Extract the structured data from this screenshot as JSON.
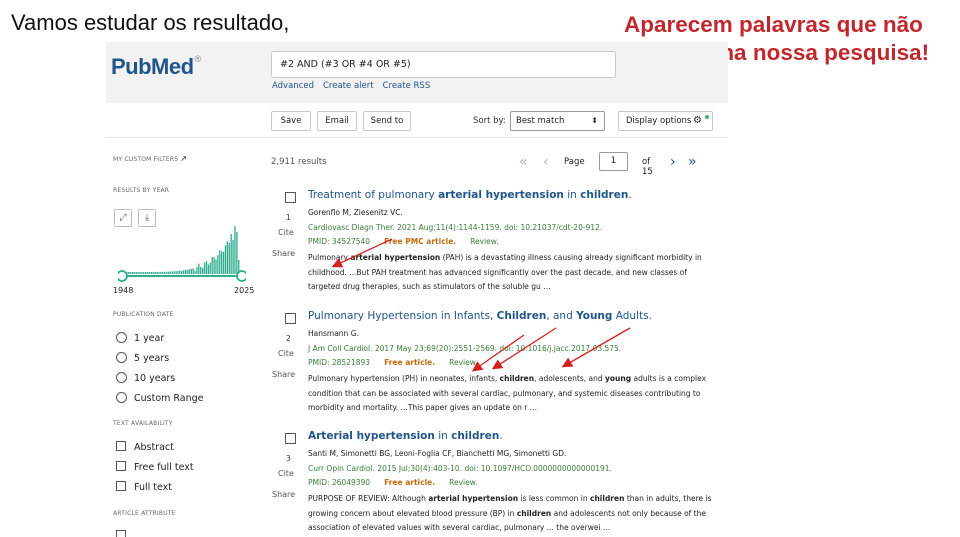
{
  "slide": {
    "caption": "Vamos estudar os resultado,",
    "note": "Aparecem palavras que não estavam na nossa pesquisa!",
    "note_color": "#c0282d"
  },
  "header": {
    "logo": "PubMed",
    "logo_mark": "®",
    "search_value": "#2 AND (#3 OR #4 OR #5)",
    "links": [
      "Advanced",
      "Create alert",
      "Create RSS"
    ]
  },
  "toolbar": {
    "save": "Save",
    "email": "Email",
    "send_to": "Send to",
    "sort_by_label": "Sort by:",
    "sort_value": "Best match",
    "display_options": "Display options"
  },
  "sidebar": {
    "custom_filters": "MY CUSTOM FILTERS",
    "results_by_year": "RESULTS BY YEAR",
    "year_start": "1948",
    "year_end": "2025",
    "publication_date": "PUBLICATION DATE",
    "date_options": [
      "1 year",
      "5 years",
      "10 years",
      "Custom Range"
    ],
    "text_availability": "TEXT AVAILABILITY",
    "text_options": [
      "Abstract",
      "Free full text",
      "Full text"
    ],
    "article_attribute": "ARTICLE ATTRIBUTE"
  },
  "results": {
    "count": "2,911 results",
    "page_label": "Page",
    "page_value": "1",
    "of_label": "of 15",
    "cite_label": "Cite",
    "share_label": "Share",
    "items": [
      {
        "num": "1",
        "authors": "Gorenflo M, Ziesenitz VC.",
        "journal": "Cardiovasc Diagn Ther. 2021 Aug;11(4):1144-1159. doi: 10.21037/cdt-20-912.",
        "pmid": "PMID: 34527540",
        "free": "Free PMC article.",
        "review": "Review."
      },
      {
        "num": "2",
        "authors": "Hansmann G.",
        "journal": "J Am Coll Cardiol. 2017 May 23;69(20):2551-2569. doi: 10.1016/j.jacc.2017.03.575.",
        "pmid": "PMID: 28521893",
        "free": "Free article.",
        "review": "Review."
      },
      {
        "num": "3",
        "authors": "Santi M, Simonetti BG, Leoni-Foglia CF, Bianchetti MG, Simonetti GD.",
        "journal": "Curr Opin Cardiol. 2015 Jul;30(4):403-10. doi: 10.1097/HCO.0000000000000191.",
        "pmid": "PMID: 26049390",
        "free": "Free article.",
        "review": "Review."
      }
    ]
  },
  "colors": {
    "link": "#20558a",
    "journal": "#3c7a3c",
    "free": "#c26b12",
    "timeline": "#2fae8f",
    "arrow": "#d42020"
  }
}
